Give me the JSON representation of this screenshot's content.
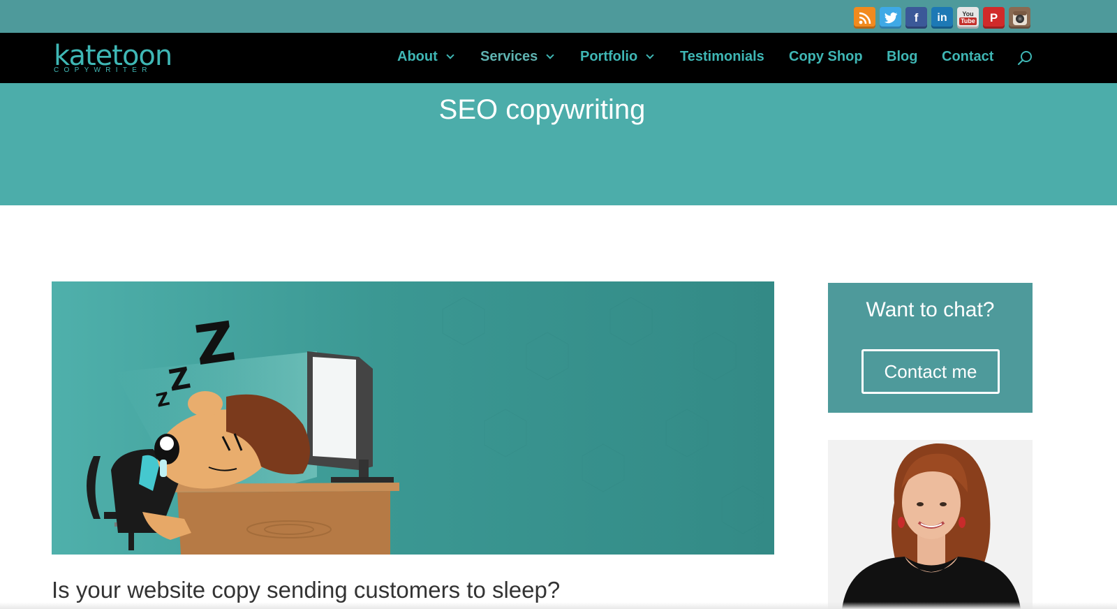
{
  "social": [
    {
      "icon": "rss-icon",
      "glyph": ")",
      "color": "#f28a1e"
    },
    {
      "icon": "twitter-icon",
      "glyph": "t",
      "color": "#3fa9e6"
    },
    {
      "icon": "facebook-icon",
      "glyph": "f",
      "color": "#3b5998"
    },
    {
      "icon": "linkedin-icon",
      "glyph": "in",
      "color": "#1d79b5"
    },
    {
      "icon": "youtube-icon",
      "glyph": "You",
      "color": "#d9d9d9"
    },
    {
      "icon": "pinterest-icon",
      "glyph": "P",
      "color": "#d12a2a"
    },
    {
      "icon": "instagram-icon",
      "glyph": "◉",
      "color": "#7a5a43"
    }
  ],
  "header": {
    "logo_main": "katetoon",
    "logo_sub": "COPYWRITER"
  },
  "nav": {
    "about": "About",
    "services": "Services",
    "portfolio": "Portfolio",
    "testimonials": "Testimonials",
    "copy_shop": "Copy Shop",
    "blog": "Blog",
    "contact": "Contact"
  },
  "hero": {
    "title": "SEO copywriting"
  },
  "main": {
    "question": "Is your website copy sending customers to sleep?"
  },
  "sidebar": {
    "chat_title": "Want to chat?",
    "chat_button": "Contact me"
  },
  "colors": {
    "topbar": "#4e9a9b",
    "accent": "#3fb7b5",
    "hero": "#4cadaa",
    "navbar": "#000000"
  }
}
